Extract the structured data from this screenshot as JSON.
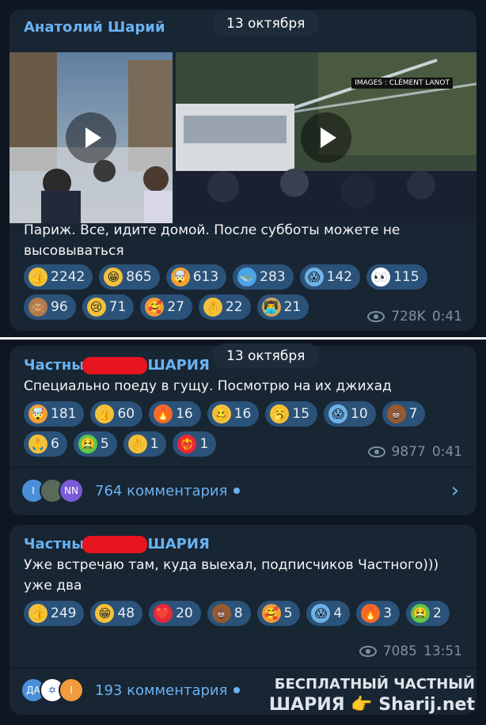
{
  "post1": {
    "author": "Анатолий Шарий",
    "date": "13 октября",
    "text": "Париж. Все, идите домой. После субботы можете не высовываться",
    "media_credit": "IMAGES : CLÉMENT LANOT",
    "reactions": [
      {
        "emoji": "thumbs-up-icon",
        "glyph": "👍",
        "count": "2242",
        "color": "#f3c13a"
      },
      {
        "emoji": "grin-icon",
        "glyph": "😁",
        "count": "865",
        "color": "#f3c13a"
      },
      {
        "emoji": "mind-blown-icon",
        "glyph": "🤯",
        "count": "613",
        "color": "#f3a13a"
      },
      {
        "emoji": "whale-icon",
        "glyph": "🐳",
        "count": "283",
        "color": "#4aa3e8"
      },
      {
        "emoji": "scream-icon",
        "glyph": "😱",
        "count": "142",
        "color": "#6fb3e8"
      },
      {
        "emoji": "eyes-icon",
        "glyph": "👀",
        "count": "115",
        "color": "#ffffff"
      },
      {
        "emoji": "see-no-evil-monkey-icon",
        "glyph": "🙈",
        "count": "96",
        "color": "#b07a4a"
      },
      {
        "emoji": "crying-icon",
        "glyph": "😢",
        "count": "71",
        "color": "#f3c13a"
      },
      {
        "emoji": "hearts-face-icon",
        "glyph": "🥰",
        "count": "27",
        "color": "#f39a3a"
      },
      {
        "emoji": "ok-hand-icon",
        "glyph": "👌",
        "count": "22",
        "color": "#f3c13a"
      },
      {
        "emoji": "technologist-icon",
        "glyph": "👨‍💻",
        "count": "21",
        "color": "#d8a45a"
      }
    ],
    "views": "728K",
    "time": "0:41"
  },
  "post2": {
    "author_left": "Частны",
    "author_right": "ШАРИЯ",
    "date": "13 октября",
    "text": "Специально поеду в гущу. Посмотрю на их джихад",
    "reactions": [
      {
        "emoji": "mind-blown-icon",
        "glyph": "🤯",
        "count": "181",
        "color": "#f3a13a"
      },
      {
        "emoji": "thumbs-up-icon",
        "glyph": "👍",
        "count": "60",
        "color": "#f3c13a"
      },
      {
        "emoji": "fire-icon",
        "glyph": "🔥",
        "count": "16",
        "color": "#f36a2a"
      },
      {
        "emoji": "woozy-face-icon",
        "glyph": "🥴",
        "count": "16",
        "color": "#f3c13a"
      },
      {
        "emoji": "yawn-icon",
        "glyph": "🥱",
        "count": "15",
        "color": "#f3c13a"
      },
      {
        "emoji": "scream-icon",
        "glyph": "😱",
        "count": "10",
        "color": "#6fb3e8"
      },
      {
        "emoji": "poop-icon",
        "glyph": "💩",
        "count": "7",
        "color": "#9a5a2a"
      },
      {
        "emoji": "pray-icon",
        "glyph": "🙏",
        "count": "6",
        "color": "#f3c13a"
      },
      {
        "emoji": "vomit-icon",
        "glyph": "🤮",
        "count": "5",
        "color": "#5ac84a"
      },
      {
        "emoji": "ok-hand-icon",
        "glyph": "👌",
        "count": "1",
        "color": "#f3c13a"
      },
      {
        "emoji": "heart-on-fire-icon",
        "glyph": "❤️‍🔥",
        "count": "1",
        "color": "#e8283a"
      }
    ],
    "views": "9877",
    "time": "0:41",
    "comments": "764 комментария",
    "avatars": [
      {
        "label": "I",
        "color": "#4a8fd8"
      },
      {
        "label": "",
        "color": "#5a6a5a"
      },
      {
        "label": "NN",
        "color": "#7a5ad8"
      }
    ]
  },
  "post3": {
    "author_left": "Частны",
    "author_right": "ШАРИЯ",
    "text": "Уже встречаю там, куда выехал, подписчиков Частного))) уже два",
    "reactions": [
      {
        "emoji": "thumbs-up-icon",
        "glyph": "👍",
        "count": "249",
        "color": "#f3c13a"
      },
      {
        "emoji": "grin-icon",
        "glyph": "😁",
        "count": "48",
        "color": "#f3c13a"
      },
      {
        "emoji": "heart-icon",
        "glyph": "❤️",
        "count": "20",
        "color": "#e8283a"
      },
      {
        "emoji": "poop-icon",
        "glyph": "💩",
        "count": "8",
        "color": "#9a5a2a"
      },
      {
        "emoji": "hearts-face-icon",
        "glyph": "🥰",
        "count": "5",
        "color": "#f39a3a"
      },
      {
        "emoji": "scream-icon",
        "glyph": "😱",
        "count": "4",
        "color": "#6fb3e8"
      },
      {
        "emoji": "fire-icon",
        "glyph": "🔥",
        "count": "3",
        "color": "#f36a2a"
      },
      {
        "emoji": "vomit-icon",
        "glyph": "🤮",
        "count": "2",
        "color": "#5ac84a"
      }
    ],
    "views": "7085",
    "time": "13:51",
    "comments": "193 комментария",
    "avatars": [
      {
        "label": "ДА",
        "color": "#4a8fd8"
      },
      {
        "label": "✡",
        "color": "#ffffff"
      },
      {
        "label": "I",
        "color": "#f39a3a"
      }
    ]
  },
  "watermark": {
    "line1": "БЕСПЛАТНЫЙ ЧАСТНЫЙ",
    "line2": "ШАРИЯ 👉 Sharij.net"
  }
}
